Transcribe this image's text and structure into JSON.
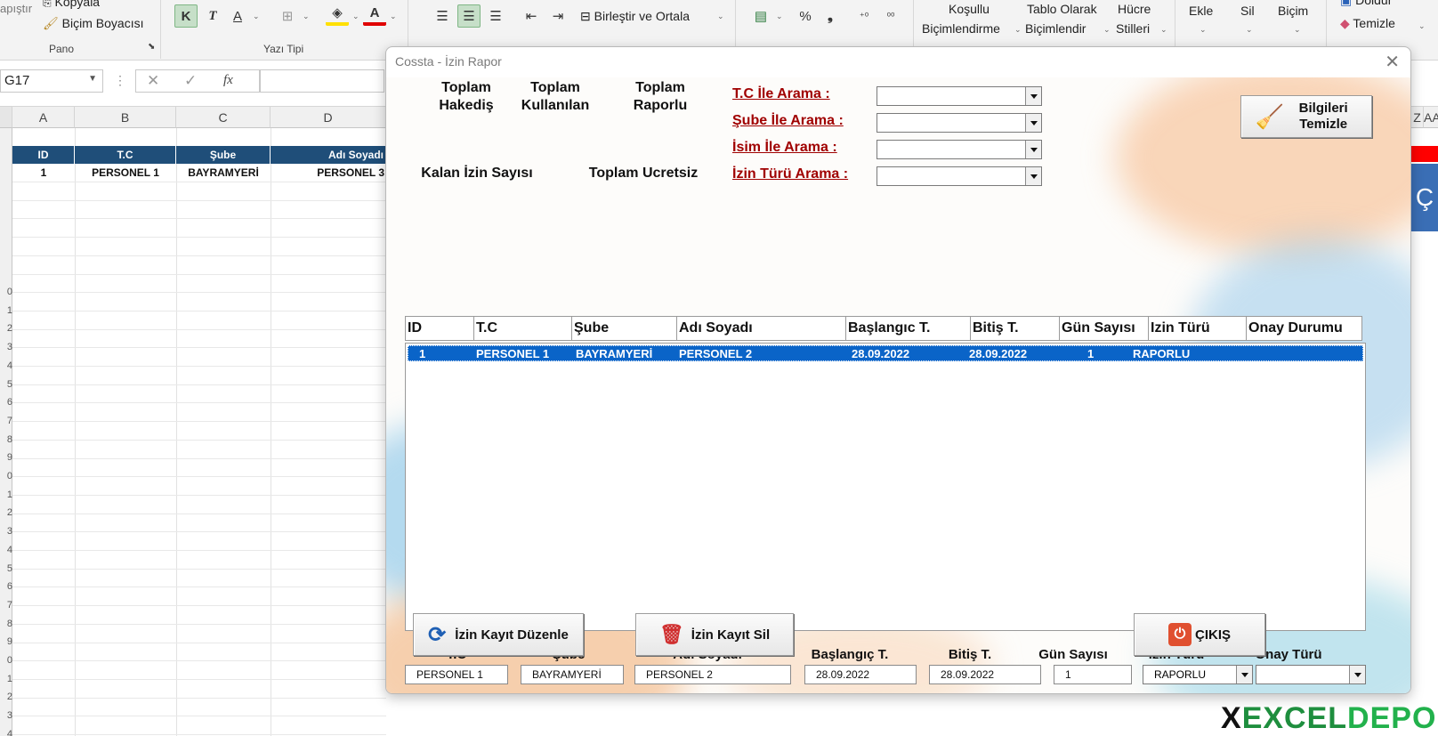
{
  "ribbon": {
    "clipboard_label_1": "apıştır",
    "copy_label": "Kopyala",
    "format_painter_label": "Biçim Boyacısı",
    "clipboard_group": "Pano",
    "font_group": "Yazı Tipi",
    "bold_label": "K",
    "italic_label": "T",
    "font_color_label": "A",
    "merge_label": "Birleştir ve Ortala",
    "percent_label": "%",
    "comma_label": "❟",
    "cond_format_1": "Koşullu",
    "cond_format_2": "Biçimlendirme",
    "table_format_1": "Tablo Olarak",
    "table_format_2": "Biçimlendir",
    "cell_styles_1": "Hücre",
    "cell_styles_2": "Stilleri",
    "insert_label": "Ekle",
    "delete_label": "Sil",
    "format_label": "Biçim",
    "fill_label": "Doldur",
    "clear_label": "Temizle"
  },
  "formula_bar": {
    "name_box": "G17",
    "fx_label": "fx"
  },
  "sheet": {
    "columns": [
      "A",
      "B",
      "C",
      "D"
    ],
    "right_columns": [
      "Z",
      "AA"
    ],
    "header_row": [
      "ID",
      "T.C",
      "Şube",
      "Adı Soyadı"
    ],
    "data_row": [
      "1",
      "PERSONEL 1",
      "BAYRAMYERİ",
      "PERSONEL 3"
    ],
    "row_numbers": [
      "0",
      "1",
      "2",
      "3",
      "4",
      "5",
      "6",
      "7",
      "8",
      "9",
      "0",
      "1",
      "2",
      "3",
      "4",
      "5",
      "6",
      "7",
      "8",
      "9",
      "0",
      "1",
      "2",
      "3",
      "4"
    ],
    "right_button_glyph": "Ç"
  },
  "dialog": {
    "title": "Cossta - İzin Rapor",
    "close_glyph": "✕",
    "stats": {
      "total_earned": "Toplam Hakediş",
      "total_used": "Toplam Kullanılan",
      "total_report": "Toplam Raporlu",
      "remaining": "Kalan İzin Sayısı",
      "total_unpaid": "Toplam Ucretsiz"
    },
    "search": {
      "tc_label": "T.C İle Arama :",
      "branch_label": "Şube İle Arama :",
      "name_label": "İsim İle Arama :",
      "type_label": "İzin Türü Arama :",
      "tc_value": "",
      "branch_value": "",
      "name_value": "",
      "type_value": ""
    },
    "clear_button": "Bilgileri Temizle",
    "list": {
      "columns": [
        "ID",
        "T.C",
        "Şube",
        "Adı Soyadı",
        "Başlangıc T.",
        "Bitiş T.",
        "Gün Sayısı",
        "Izin Türü",
        "Onay Durumu"
      ],
      "rows": [
        [
          "1",
          "PERSONEL 1",
          "BAYRAMYERİ",
          "PERSONEL 2",
          "28.09.2022",
          "28.09.2022",
          "1",
          "RAPORLU",
          ""
        ]
      ]
    },
    "form": {
      "labels": [
        "T.C",
        "Şube",
        "Adı Soyadı",
        "Başlangıç T.",
        "Bitiş T.",
        "Gün Sayısı",
        "Izin Türü",
        "Onay Türü"
      ],
      "tc": "PERSONEL 1",
      "branch": "BAYRAMYERİ",
      "name": "PERSONEL 2",
      "start": "28.09.2022",
      "end": "28.09.2022",
      "days": "1",
      "leave_type": "RAPORLU",
      "approval": ""
    },
    "edit_button": "İzin Kayıt Düzenle",
    "delete_button": "İzin Kayıt Sil",
    "exit_button": "ÇIKIŞ"
  },
  "watermark": {
    "prefix": "X",
    "excel": "EXCEL",
    "depo": "DEPO"
  },
  "colors": {
    "header_blue": "#1f4e79",
    "selection_blue": "#0a64c8",
    "search_red": "#a00000",
    "accent_green": "#1e8e3e",
    "accent_red": "#e03030"
  }
}
